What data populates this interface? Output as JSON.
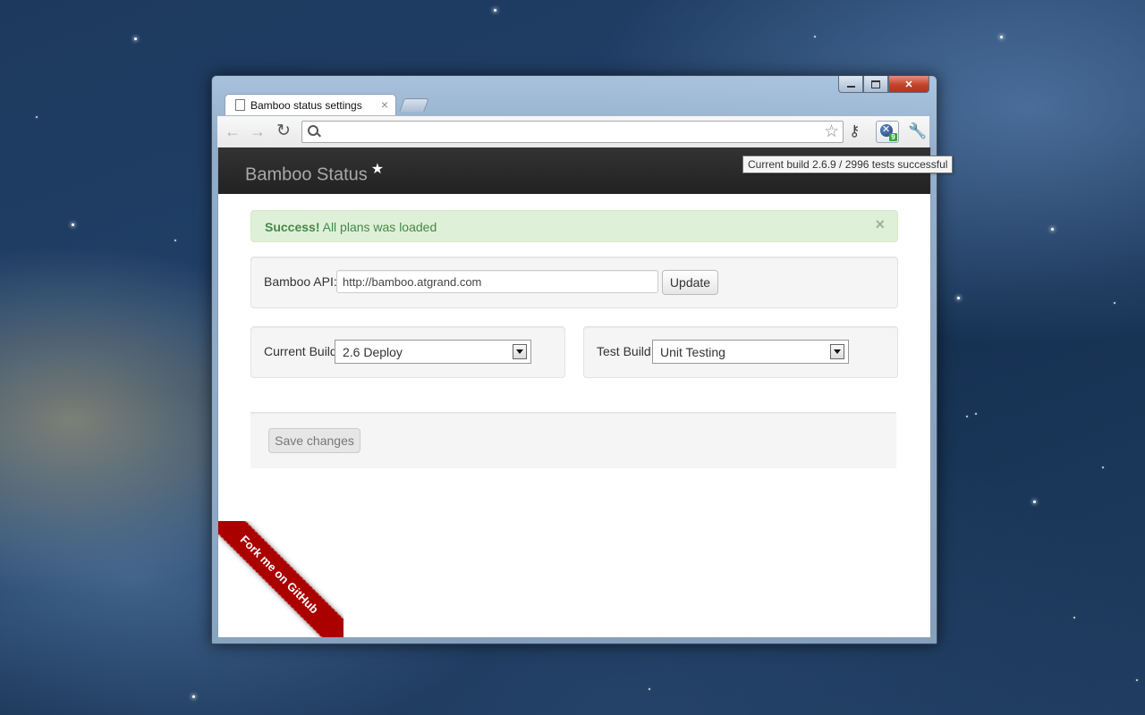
{
  "browser": {
    "tab_title": "Bamboo status settings",
    "tab_close": "×",
    "address_value": "",
    "extension_badge": "9",
    "tooltip": "Current build 2.6.9 / 2996 tests successful"
  },
  "navbar": {
    "brand": "Bamboo Status",
    "brand_star": "★"
  },
  "alert": {
    "title": "Success!",
    "message": " All plans was loaded",
    "close": "×"
  },
  "api": {
    "label": "Bamboo API:",
    "value": "http://bamboo.atgrand.com",
    "button": "Update"
  },
  "current_build": {
    "label": "Current Build",
    "selected": "2.6 Deploy"
  },
  "test_build": {
    "label": "Test Build",
    "selected": "Unit Testing"
  },
  "actions": {
    "save": "Save changes"
  },
  "ribbon": {
    "text": "Fork me on GitHub"
  },
  "icons": [
    "back-arrow-icon",
    "forward-arrow-icon",
    "reload-icon",
    "search-icon",
    "bookmark-star-icon",
    "key-icon",
    "bamboo-extension-icon",
    "wrench-icon",
    "page-icon"
  ]
}
